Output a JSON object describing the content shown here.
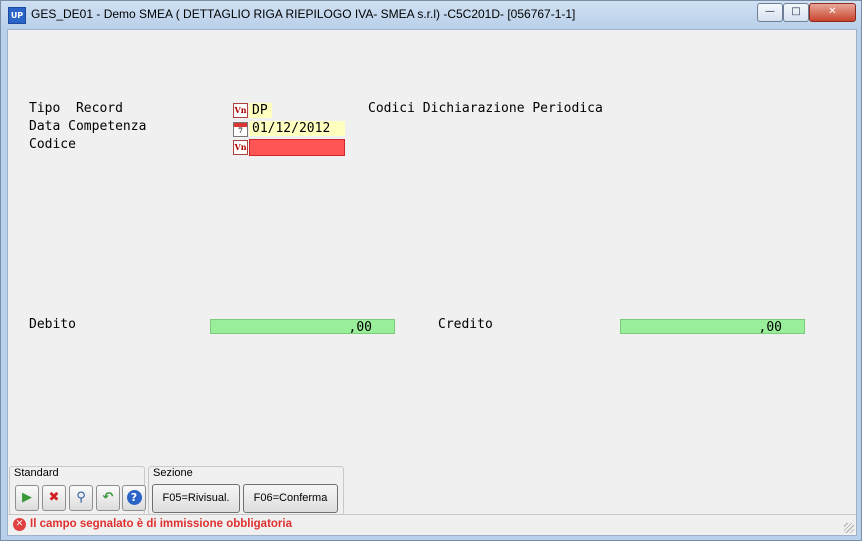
{
  "window": {
    "title": "GES_DE01 - Demo SMEA (  DETTAGLIO RIGA RIEPILOGO IVA- SMEA s.r.l) -C5C201D- [056767-1-1]",
    "app_icon_label": "UP",
    "min_label": "—",
    "max_label": "□",
    "close_label": "✕"
  },
  "form": {
    "tipo_record_label": "Tipo  Record",
    "tipo_record_value": "DP",
    "tipo_record_desc": "Codici Dichiarazione Periodica",
    "data_competenza_label": "Data Competenza",
    "data_competenza_value": "01/12/2012",
    "codice_label": "Codice",
    "codice_value": "",
    "debito_label": "Debito",
    "debito_value": ",00",
    "credito_label": "Credito",
    "credito_value": ",00"
  },
  "toolbar": {
    "standard_title": "Standard",
    "sezione_title": "Sezione",
    "f05_label": "F05=Rivisual.",
    "f06_label": "F06=Conferma"
  },
  "status": {
    "message": "Il campo segnalato è di immissione obbligatoria",
    "color": "#e03030"
  },
  "colors": {
    "required_field": "#ff5555",
    "input_field": "#ffffc0",
    "amount_field": "#99ee99"
  }
}
